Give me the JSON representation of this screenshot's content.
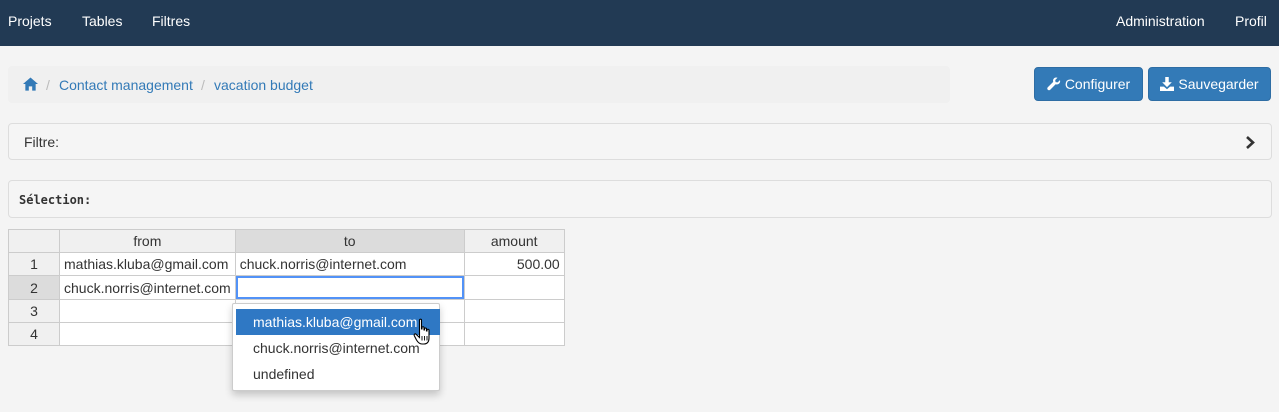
{
  "nav": {
    "left": [
      "Projets",
      "Tables",
      "Filtres"
    ],
    "right": [
      "Administration",
      "Profil"
    ]
  },
  "breadcrumb": {
    "home_icon": "home-icon",
    "items": [
      "Contact management",
      "vacation budget"
    ],
    "separator": "/"
  },
  "toolbar": {
    "configure_label": "Configurer",
    "configure_icon": "wrench-icon",
    "save_label": "Sauvegarder",
    "save_icon": "download-icon"
  },
  "filter": {
    "label": "Filtre:",
    "toggle_icon": "chevron-right-icon"
  },
  "selection": {
    "label": "Sélection:"
  },
  "grid": {
    "columns": [
      "from",
      "to",
      "amount"
    ],
    "rows": [
      {
        "num": "1",
        "from": "mathias.kluba@gmail.com",
        "to": "chuck.norris@internet.com",
        "amount": "500.00"
      },
      {
        "num": "2",
        "from": "chuck.norris@internet.com",
        "to": "",
        "amount": ""
      },
      {
        "num": "3",
        "from": "",
        "to": "",
        "amount": ""
      },
      {
        "num": "4",
        "from": "",
        "to": "",
        "amount": ""
      }
    ]
  },
  "dropdown": {
    "options": [
      "mathias.kluba@gmail.com",
      "chuck.norris@internet.com",
      "undefined"
    ],
    "highlighted": "mathias.kluba@gmail.com"
  },
  "colors": {
    "navbar": "#223a54",
    "primary_button": "#337ab7",
    "highlight": "#2f78c4",
    "link": "#337ab7"
  }
}
